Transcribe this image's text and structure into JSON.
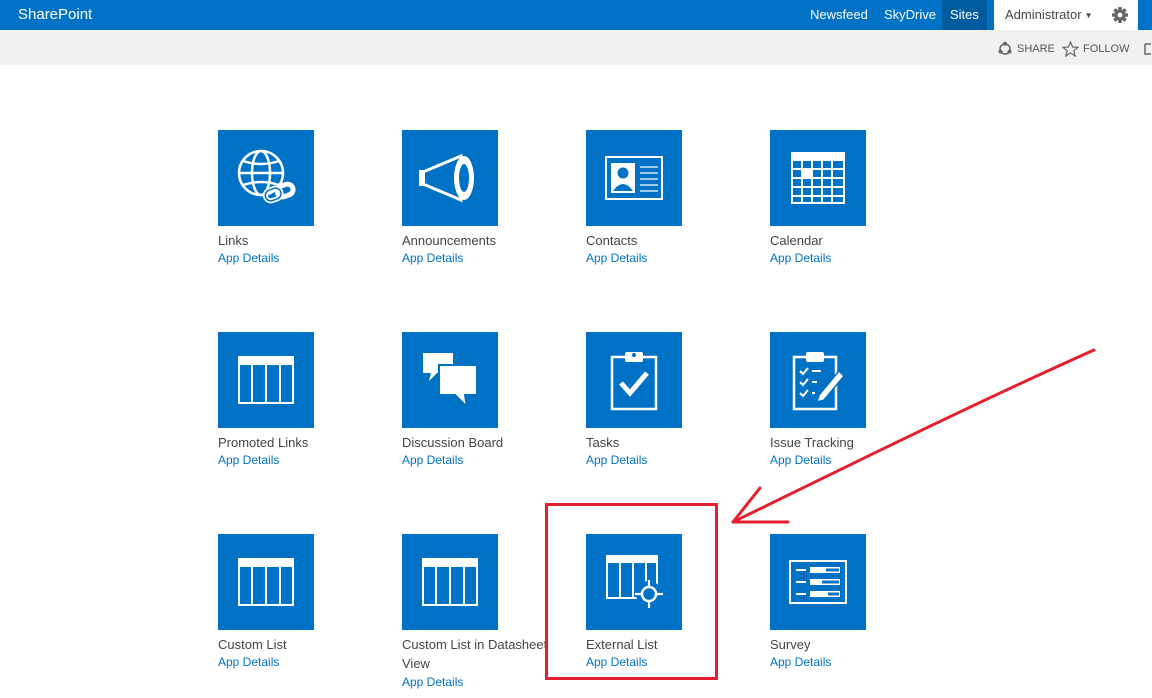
{
  "suitebar": {
    "brand": "SharePoint",
    "nav": [
      {
        "label": "Newsfeed",
        "active": false
      },
      {
        "label": "SkyDrive",
        "active": false
      },
      {
        "label": "Sites",
        "active": true
      }
    ],
    "user": "Administrator",
    "settings_icon": "gear-icon",
    "colors": {
      "bar": "#0072c6",
      "active": "#005a9e"
    }
  },
  "subbar": {
    "share_label": "SHARE",
    "follow_label": "FOLLOW"
  },
  "apps": [
    {
      "name": "Links",
      "details": "App Details",
      "icon": "globe-link-icon"
    },
    {
      "name": "Announcements",
      "details": "App Details",
      "icon": "megaphone-icon"
    },
    {
      "name": "Contacts",
      "details": "App Details",
      "icon": "contact-card-icon"
    },
    {
      "name": "Calendar",
      "details": "App Details",
      "icon": "calendar-icon"
    },
    {
      "name": "Promoted Links",
      "details": "App Details",
      "icon": "list-grid-icon"
    },
    {
      "name": "Discussion Board",
      "details": "App Details",
      "icon": "speech-bubbles-icon"
    },
    {
      "name": "Tasks",
      "details": "App Details",
      "icon": "clipboard-check-icon"
    },
    {
      "name": "Issue Tracking",
      "details": "App Details",
      "icon": "clipboard-pencil-icon"
    },
    {
      "name": "Custom List",
      "details": "App Details",
      "icon": "list-grid-icon"
    },
    {
      "name": "Custom List in Datasheet View",
      "details": "App Details",
      "icon": "list-grid-icon"
    },
    {
      "name": "External List",
      "details": "App Details",
      "icon": "external-list-icon"
    },
    {
      "name": "Survey",
      "details": "App Details",
      "icon": "survey-icon"
    }
  ],
  "annotation": {
    "highlighted_app": "External List",
    "color": "#e4202e"
  }
}
